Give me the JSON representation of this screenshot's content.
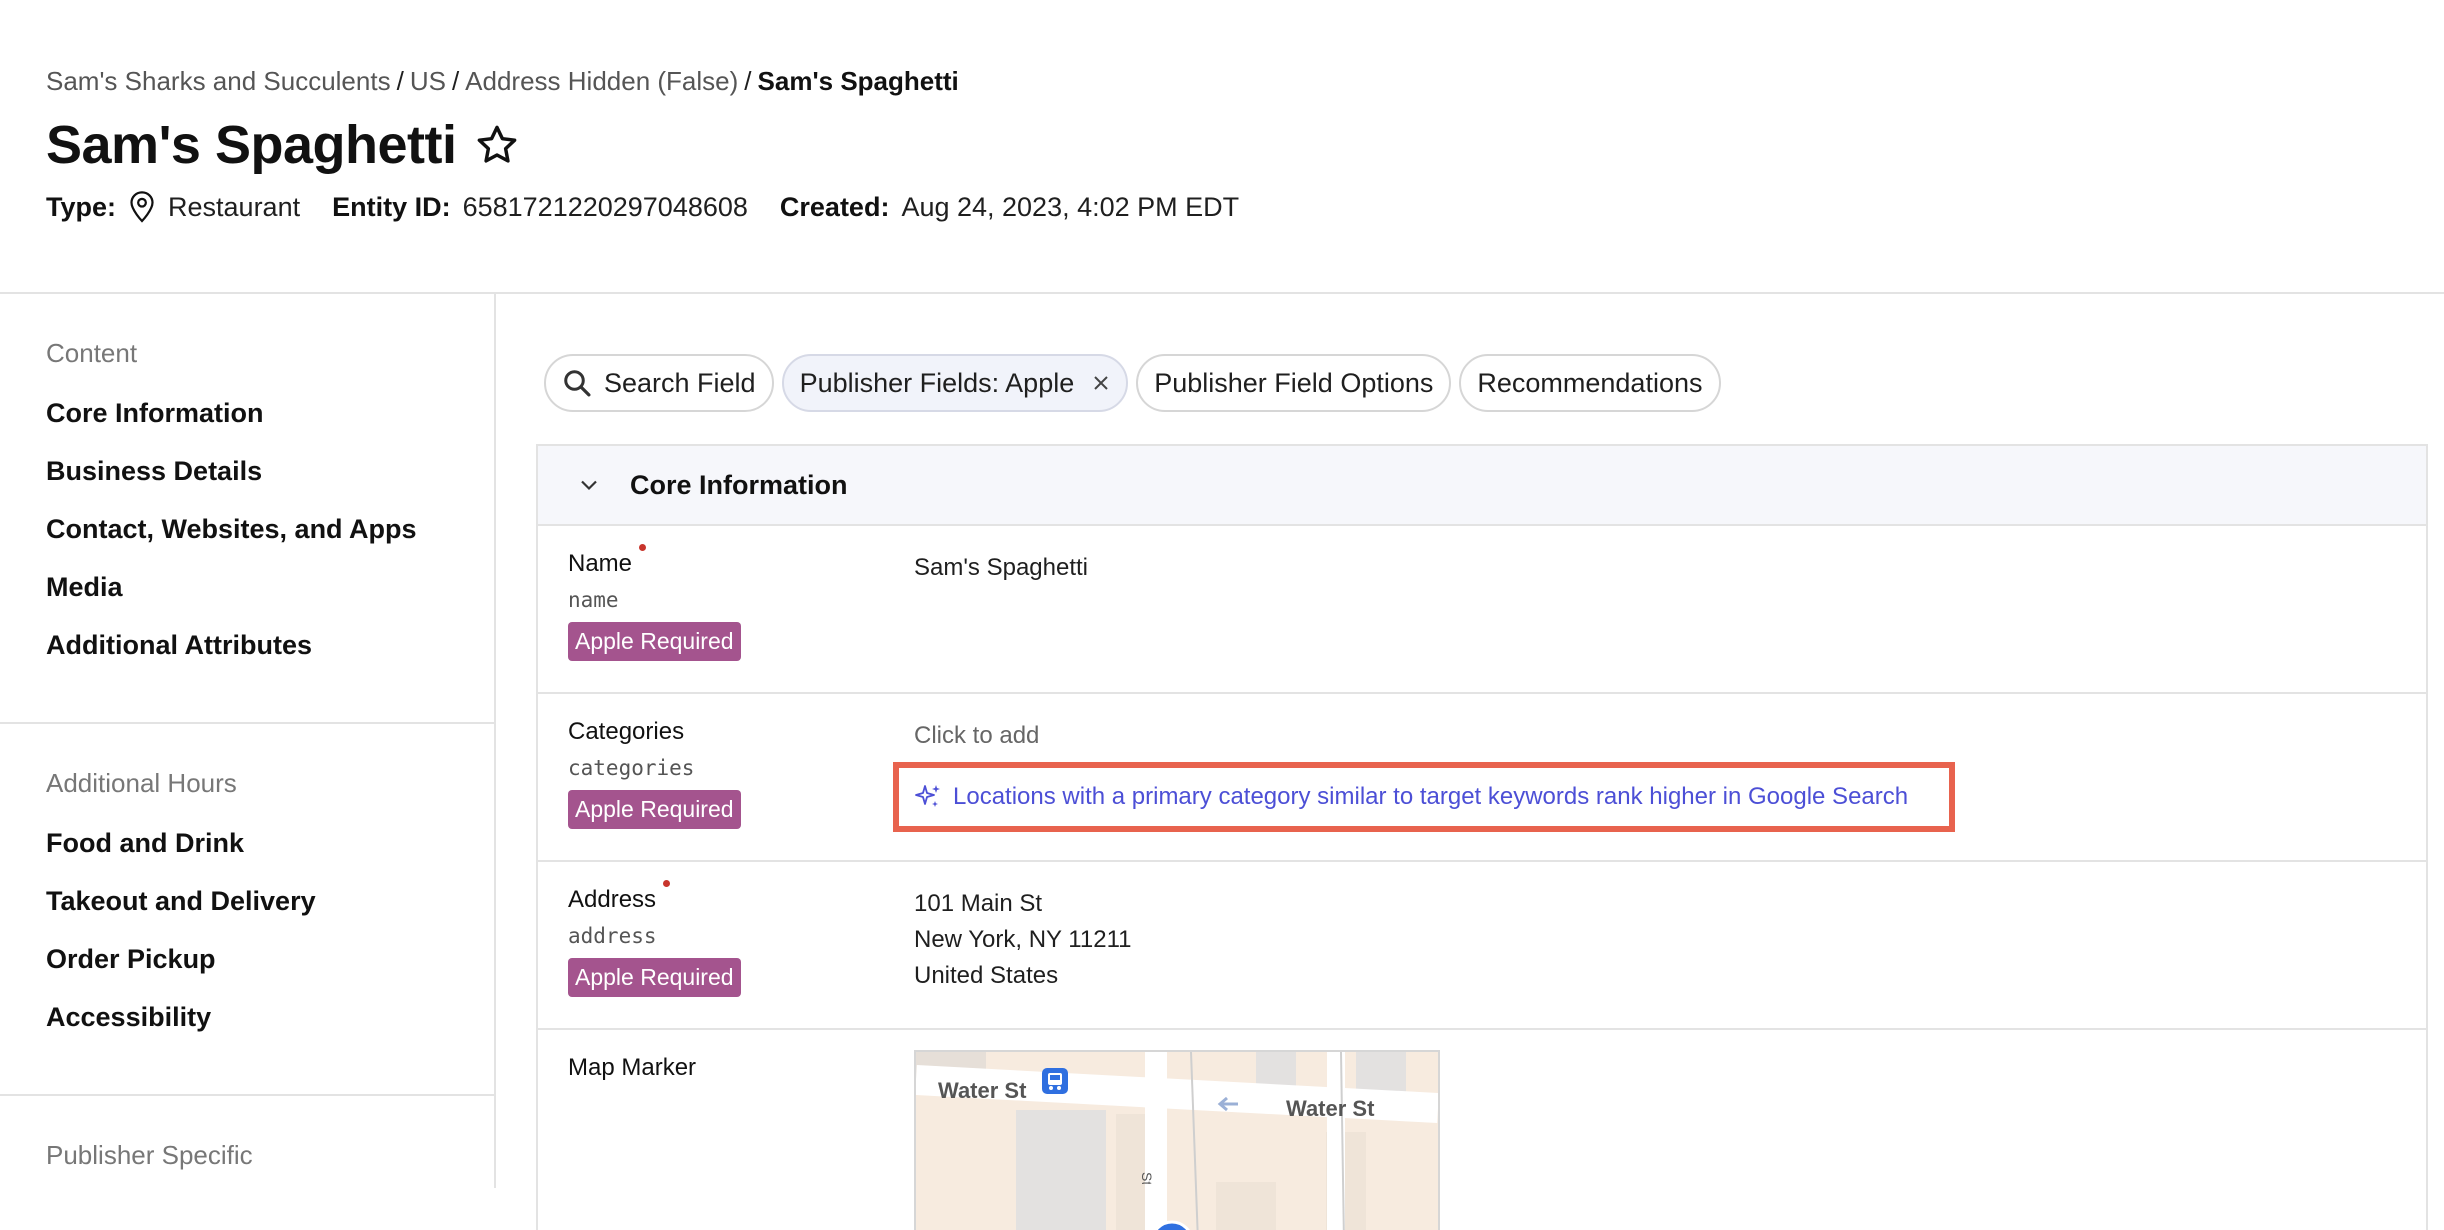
{
  "breadcrumb": {
    "items": [
      "Sam's Sharks and Succulents",
      "US",
      "Address Hidden (False)"
    ],
    "separator": "/",
    "current": "Sam's Spaghetti"
  },
  "header": {
    "title": "Sam's Spaghetti",
    "type_label": "Type:",
    "type_value": "Restaurant",
    "entity_id_label": "Entity ID:",
    "entity_id_value": "6581721220297048608",
    "created_label": "Created:",
    "created_value": "Aug 24, 2023, 4:02 PM EDT"
  },
  "sidebar": {
    "sections": [
      {
        "heading": "Content",
        "items": [
          "Core Information",
          "Business Details",
          "Contact, Websites, and Apps",
          "Media",
          "Additional Attributes"
        ]
      },
      {
        "heading": "Additional Hours",
        "items": [
          "Food and Drink",
          "Takeout and Delivery",
          "Order Pickup",
          "Accessibility"
        ]
      },
      {
        "heading": "Publisher Specific",
        "items": []
      }
    ]
  },
  "filters": {
    "search": "Search Field",
    "publisher_fields": "Publisher Fields: Apple",
    "publisher_field_options": "Publisher Field Options",
    "recommendations": "Recommendations"
  },
  "panel": {
    "title": "Core Information",
    "fields": {
      "name": {
        "label": "Name",
        "key": "name",
        "badge": "Apple Required",
        "value": "Sam's Spaghetti"
      },
      "categories": {
        "label": "Categories",
        "key": "categories",
        "badge": "Apple Required",
        "placeholder": "Click to add",
        "insight": "Locations with a primary category similar to target keywords rank higher in Google Search"
      },
      "address": {
        "label": "Address",
        "key": "address",
        "badge": "Apple Required",
        "line1": "101 Main St",
        "line2": "New York, NY 11211",
        "line3": "United States"
      },
      "map_marker": {
        "label": "Map Marker",
        "street_left": "Water St",
        "street_right": "Water St"
      }
    }
  },
  "colors": {
    "badge": "#a4548e",
    "required_dot": "#c8352c",
    "insight_link": "#4c4fd6",
    "highlight_border": "#e8634e"
  },
  "icons": [
    "star-icon",
    "pin-icon",
    "search-icon",
    "close-icon",
    "chevron-down-icon",
    "sparkle-icon",
    "bus-icon",
    "arrow-left-icon",
    "map-marker-icon"
  ]
}
